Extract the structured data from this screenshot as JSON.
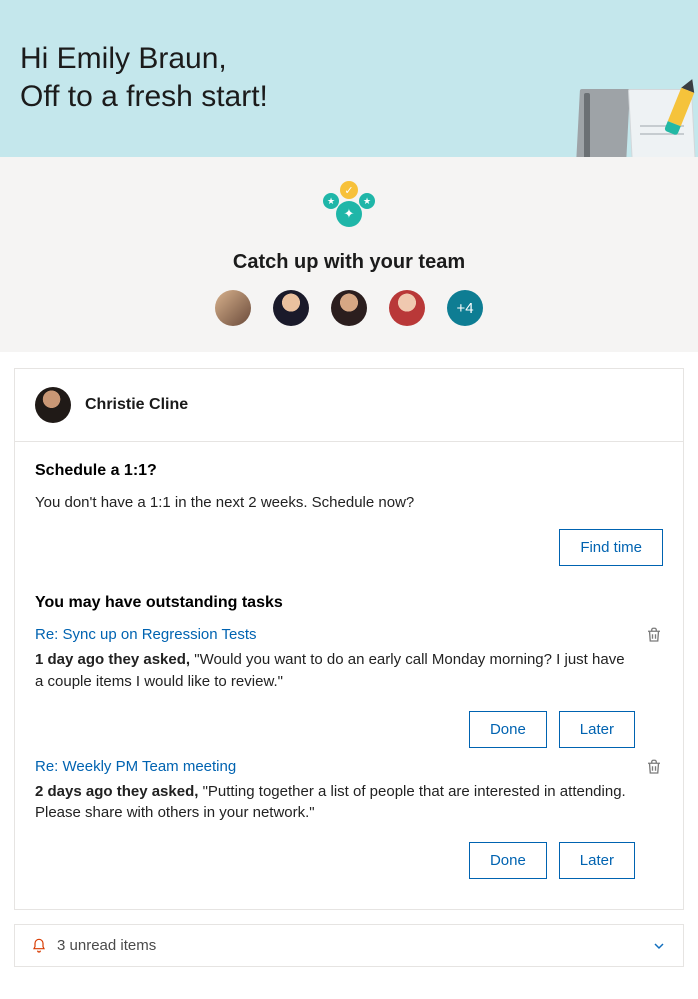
{
  "header": {
    "greeting_line1": "Hi Emily Braun,",
    "greeting_line2": "Off to a fresh start!"
  },
  "catch_up": {
    "title": "Catch up with your team",
    "avatars": [
      {
        "name": "Person 1"
      },
      {
        "name": "Person 2"
      },
      {
        "name": "Person 3"
      },
      {
        "name": "Person 4"
      }
    ],
    "more_label": "+4"
  },
  "card": {
    "person_name": "Christie Cline",
    "schedule": {
      "title": "Schedule a 1:1?",
      "text": "You don't have a 1:1 in the next 2 weeks. Schedule now?",
      "button": "Find time"
    },
    "tasks_section_title": "You may have outstanding tasks",
    "tasks": [
      {
        "subject": "Re: Sync up on Regression Tests",
        "ago": "1 day ago they asked,",
        "quote": "\"Would you want to do an early call Monday morning? I just have a couple items I would like to review.\"",
        "done": "Done",
        "later": "Later"
      },
      {
        "subject": "Re: Weekly PM Team meeting",
        "ago": "2 days ago they asked,",
        "quote": "\"Putting together a list of people that are interested in attending. Please share with others in your network.\"",
        "done": "Done",
        "later": "Later"
      }
    ]
  },
  "footer": {
    "unread_text": "3 unread items",
    "unread_count": 3
  }
}
